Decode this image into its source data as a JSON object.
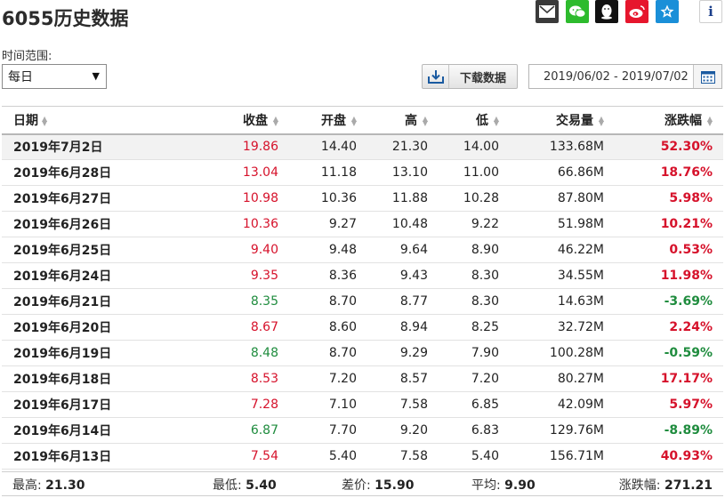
{
  "page": {
    "title": "6055历史数据"
  },
  "share_icons": {
    "mail": "mail-icon",
    "wechat": "wechat-icon",
    "qq": "qq-icon",
    "weibo": "weibo-icon",
    "favorite": "star-icon",
    "info": "i"
  },
  "controls": {
    "range_label": "时间范围:",
    "range_value": "每日",
    "download_label": "下载数据",
    "date_range": "2019/06/02 - 2019/07/02"
  },
  "table": {
    "headers": [
      "日期",
      "收盘",
      "开盘",
      "高",
      "低",
      "交易量",
      "涨跌幅"
    ],
    "rows": [
      {
        "date": "2019年7月2日",
        "close": "19.86",
        "open": "14.40",
        "high": "21.30",
        "low": "14.00",
        "volume": "133.68M",
        "change": "52.30%",
        "dir": "up"
      },
      {
        "date": "2019年6月28日",
        "close": "13.04",
        "open": "11.18",
        "high": "13.10",
        "low": "11.00",
        "volume": "66.86M",
        "change": "18.76%",
        "dir": "up"
      },
      {
        "date": "2019年6月27日",
        "close": "10.98",
        "open": "10.36",
        "high": "11.88",
        "low": "10.28",
        "volume": "87.80M",
        "change": "5.98%",
        "dir": "up"
      },
      {
        "date": "2019年6月26日",
        "close": "10.36",
        "open": "9.27",
        "high": "10.48",
        "low": "9.22",
        "volume": "51.98M",
        "change": "10.21%",
        "dir": "up"
      },
      {
        "date": "2019年6月25日",
        "close": "9.40",
        "open": "9.48",
        "high": "9.64",
        "low": "8.90",
        "volume": "46.22M",
        "change": "0.53%",
        "dir": "up"
      },
      {
        "date": "2019年6月24日",
        "close": "9.35",
        "open": "8.36",
        "high": "9.43",
        "low": "8.30",
        "volume": "34.55M",
        "change": "11.98%",
        "dir": "up"
      },
      {
        "date": "2019年6月21日",
        "close": "8.35",
        "open": "8.70",
        "high": "8.77",
        "low": "8.30",
        "volume": "14.63M",
        "change": "-3.69%",
        "dir": "down"
      },
      {
        "date": "2019年6月20日",
        "close": "8.67",
        "open": "8.60",
        "high": "8.94",
        "low": "8.25",
        "volume": "32.72M",
        "change": "2.24%",
        "dir": "up"
      },
      {
        "date": "2019年6月19日",
        "close": "8.48",
        "open": "8.70",
        "high": "9.29",
        "low": "7.90",
        "volume": "100.28M",
        "change": "-0.59%",
        "dir": "down"
      },
      {
        "date": "2019年6月18日",
        "close": "8.53",
        "open": "7.20",
        "high": "8.57",
        "low": "7.20",
        "volume": "80.27M",
        "change": "17.17%",
        "dir": "up"
      },
      {
        "date": "2019年6月17日",
        "close": "7.28",
        "open": "7.10",
        "high": "7.58",
        "low": "6.85",
        "volume": "42.09M",
        "change": "5.97%",
        "dir": "up"
      },
      {
        "date": "2019年6月14日",
        "close": "6.87",
        "open": "7.70",
        "high": "9.20",
        "low": "6.83",
        "volume": "129.76M",
        "change": "-8.89%",
        "dir": "down"
      },
      {
        "date": "2019年6月13日",
        "close": "7.54",
        "open": "5.40",
        "high": "7.58",
        "low": "5.40",
        "volume": "156.71M",
        "change": "40.93%",
        "dir": "up"
      }
    ]
  },
  "summary": {
    "high_label": "最高:",
    "high_value": "21.30",
    "low_label": "最低:",
    "low_value": "5.40",
    "diff_label": "差价:",
    "diff_value": "15.90",
    "avg_label": "平均:",
    "avg_value": "9.90",
    "change_label": "涨跌幅:",
    "change_value": "271.21"
  },
  "colors": {
    "up": "#d6122b",
    "down": "#1f8c3e"
  }
}
